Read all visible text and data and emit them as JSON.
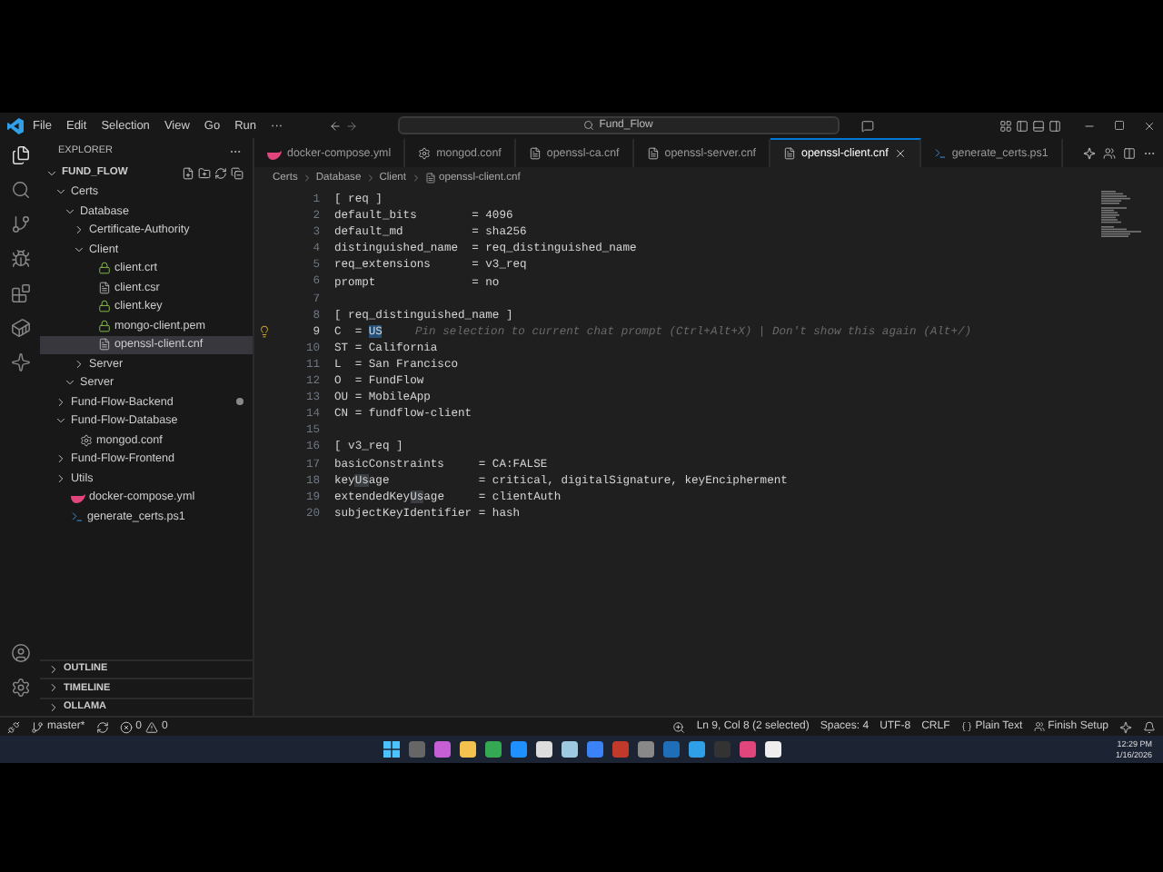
{
  "menu": [
    "File",
    "Edit",
    "Selection",
    "View",
    "Go",
    "Run",
    "···"
  ],
  "search": {
    "value": "Fund_Flow"
  },
  "tabs": [
    {
      "label": "docker-compose.yml",
      "kind": "docker",
      "selected": false
    },
    {
      "label": "mongod.conf",
      "kind": "config",
      "selected": false
    },
    {
      "label": "openssl-ca.cnf",
      "kind": "text",
      "selected": false
    },
    {
      "label": "openssl-server.cnf",
      "kind": "text",
      "selected": false
    },
    {
      "label": "openssl-client.cnf",
      "kind": "text",
      "selected": true
    },
    {
      "label": "generate_certs.ps1",
      "kind": "script",
      "selected": false
    }
  ],
  "breadcrumbs": [
    "Certs",
    "Database",
    "Client",
    "openssl-client.cnf"
  ],
  "explorer": {
    "title": "EXPLORER",
    "root": "FUND_FLOW",
    "tree": [
      {
        "label": "Certs",
        "kind": "folder",
        "expanded": true,
        "selected": false,
        "modified": false,
        "children": [
          {
            "label": "Database",
            "kind": "folder",
            "expanded": true,
            "selected": false,
            "modified": false,
            "children": [
              {
                "label": "Certificate-Authority",
                "kind": "folder",
                "expanded": false,
                "selected": false,
                "modified": false
              },
              {
                "label": "Client",
                "kind": "folder",
                "expanded": true,
                "selected": false,
                "modified": false,
                "children": [
                  {
                    "label": "client.crt",
                    "kind": "cert",
                    "selected": false,
                    "modified": false
                  },
                  {
                    "label": "client.csr",
                    "kind": "text",
                    "selected": false,
                    "modified": false
                  },
                  {
                    "label": "client.key",
                    "kind": "cert",
                    "selected": false,
                    "modified": false
                  },
                  {
                    "label": "mongo-client.pem",
                    "kind": "cert",
                    "selected": false,
                    "modified": false
                  },
                  {
                    "label": "openssl-client.cnf",
                    "kind": "text",
                    "selected": true,
                    "modified": false
                  }
                ]
              },
              {
                "label": "Server",
                "kind": "folder",
                "expanded": false,
                "selected": false,
                "modified": false
              }
            ]
          },
          {
            "label": "Server",
            "kind": "folder",
            "expanded": true,
            "selected": false,
            "modified": false
          }
        ]
      },
      {
        "label": "Fund-Flow-Backend",
        "kind": "folder",
        "expanded": false,
        "selected": false,
        "modified": true
      },
      {
        "label": "Fund-Flow-Database",
        "kind": "folder",
        "expanded": true,
        "selected": false,
        "modified": false,
        "children": [
          {
            "label": "mongod.conf",
            "kind": "config",
            "selected": false,
            "modified": false
          }
        ]
      },
      {
        "label": "Fund-Flow-Frontend",
        "kind": "folder",
        "expanded": false,
        "selected": false,
        "modified": false
      },
      {
        "label": "Utils",
        "kind": "folder",
        "expanded": false,
        "selected": false,
        "modified": false
      },
      {
        "label": "docker-compose.yml",
        "kind": "docker",
        "selected": false,
        "modified": false
      },
      {
        "label": "generate_certs.ps1",
        "kind": "script",
        "selected": false,
        "modified": false
      }
    ]
  },
  "panels": [
    {
      "label": "OUTLINE",
      "expanded": false
    },
    {
      "label": "TIMELINE",
      "expanded": false
    },
    {
      "label": "OLLAMA",
      "expanded": false
    }
  ],
  "lines": [
    {
      "number": "1",
      "current": false,
      "parts": [
        {
          "text": "[ req ]",
          "kind": "code"
        }
      ]
    },
    {
      "number": "2",
      "current": false,
      "parts": [
        {
          "text": "default_bits        = 4096",
          "kind": "code"
        }
      ]
    },
    {
      "number": "3",
      "current": false,
      "parts": [
        {
          "text": "default_md          = sha256",
          "kind": "code"
        }
      ]
    },
    {
      "number": "4",
      "current": false,
      "parts": [
        {
          "text": "distinguished_name  = req_distinguished_name",
          "kind": "code"
        }
      ]
    },
    {
      "number": "5",
      "current": false,
      "parts": [
        {
          "text": "req_extensions      = v3_req",
          "kind": "code"
        }
      ]
    },
    {
      "number": "6",
      "current": false,
      "parts": [
        {
          "text": "prompt              = no",
          "kind": "code"
        }
      ]
    },
    {
      "number": "7",
      "current": false
    },
    {
      "number": "8",
      "current": false,
      "parts": [
        {
          "text": "[ req_distinguished_name ]",
          "kind": "code"
        }
      ]
    },
    {
      "number": "9",
      "current": true,
      "parts": [
        {
          "text": "C  = ",
          "kind": "code"
        },
        {
          "text": "US",
          "kind": "selection"
        },
        {
          "text": "Pin selection to current chat prompt (Ctrl+Alt+X) | Don't show this again (Alt+/)",
          "kind": "hint"
        }
      ]
    },
    {
      "number": "10",
      "current": false,
      "parts": [
        {
          "text": "ST = California",
          "kind": "code"
        }
      ]
    },
    {
      "number": "11",
      "current": false,
      "parts": [
        {
          "text": "L  = San Francisco",
          "kind": "code"
        }
      ]
    },
    {
      "number": "12",
      "current": false,
      "parts": [
        {
          "text": "O  = FundFlow",
          "kind": "code"
        }
      ]
    },
    {
      "number": "13",
      "current": false,
      "parts": [
        {
          "text": "OU = MobileApp",
          "kind": "code"
        }
      ]
    },
    {
      "number": "14",
      "current": false,
      "parts": [
        {
          "text": "CN = fundflow-client",
          "kind": "code"
        }
      ]
    },
    {
      "number": "15",
      "current": false
    },
    {
      "number": "16",
      "current": false,
      "parts": [
        {
          "text": "[ v3_req ]",
          "kind": "code"
        }
      ]
    },
    {
      "number": "17",
      "current": false,
      "parts": [
        {
          "text": "basicConstraints     = CA:FALSE",
          "kind": "code"
        }
      ]
    },
    {
      "number": "18",
      "current": false,
      "parts": [
        {
          "text": "key",
          "kind": "code"
        },
        {
          "text": "Us",
          "kind": "match"
        },
        {
          "text": "age             = critical, digitalSignature, keyEncipherment",
          "kind": "code"
        }
      ]
    },
    {
      "number": "19",
      "current": false,
      "parts": [
        {
          "text": "extendedKey",
          "kind": "code"
        },
        {
          "text": "Us",
          "kind": "match"
        },
        {
          "text": "age     = clientAuth",
          "kind": "code"
        }
      ]
    },
    {
      "number": "20",
      "current": false,
      "parts": [
        {
          "text": "subjectKeyIdentifier = hash",
          "kind": "code"
        }
      ]
    }
  ],
  "status": {
    "branch": "master*",
    "errors": "0",
    "warnings": "0",
    "right": [
      "Ln 9, Col 8 (2 selected)",
      "Spaces: 4",
      "UTF-8",
      "CRLF",
      "Plain Text",
      "Finish Setup"
    ]
  },
  "clock": {
    "time": "12:29 PM",
    "date": "1/16/2026"
  }
}
